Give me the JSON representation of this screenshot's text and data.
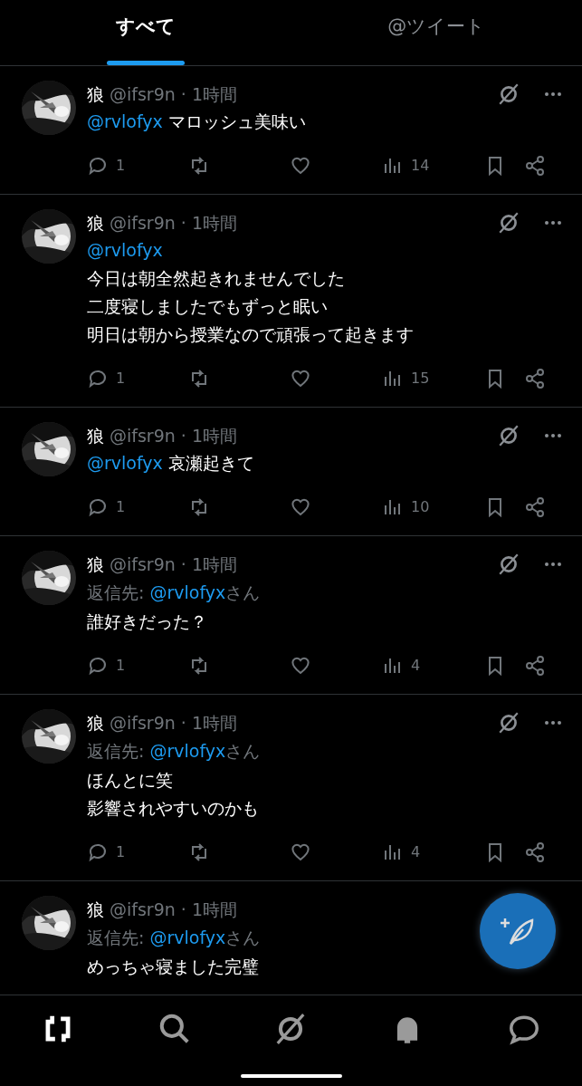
{
  "tabs": [
    {
      "label": "すべて",
      "selected": true
    },
    {
      "label": "@ツイート",
      "selected": false
    }
  ],
  "tweets": [
    {
      "name": "狼",
      "handle": "@ifsr9n",
      "time": "· 1時間",
      "body": [
        [
          {
            "kind": "mention",
            "text": "@rvlofyx"
          },
          {
            "kind": "text",
            "text": " マロッシュ美味い"
          }
        ]
      ],
      "replies": "1",
      "views": "14"
    },
    {
      "name": "狼",
      "handle": "@ifsr9n",
      "time": "· 1時間",
      "body": [
        [
          {
            "kind": "mention",
            "text": "@rvlofyx"
          }
        ],
        [
          {
            "kind": "text",
            "text": "今日は朝全然起きれませんでした"
          }
        ],
        [
          {
            "kind": "text",
            "text": "二度寝しましたでもずっと眠い"
          }
        ],
        [
          {
            "kind": "text",
            "text": "明日は朝から授業なので頑張って起きます"
          }
        ]
      ],
      "replies": "1",
      "views": "15"
    },
    {
      "name": "狼",
      "handle": "@ifsr9n",
      "time": "· 1時間",
      "body": [
        [
          {
            "kind": "mention",
            "text": "@rvlofyx"
          },
          {
            "kind": "text",
            "text": " 哀瀬起きて"
          }
        ]
      ],
      "replies": "1",
      "views": "10"
    },
    {
      "name": "狼",
      "handle": "@ifsr9n",
      "time": "· 1時間",
      "reply_to": {
        "prefix": "返信先: ",
        "handle": "@rvlofyx",
        "suffix": "さん"
      },
      "body": [
        [
          {
            "kind": "text",
            "text": "誰好きだった？"
          }
        ]
      ],
      "replies": "1",
      "views": "4"
    },
    {
      "name": "狼",
      "handle": "@ifsr9n",
      "time": "· 1時間",
      "reply_to": {
        "prefix": "返信先: ",
        "handle": "@rvlofyx",
        "suffix": "さん"
      },
      "body": [
        [
          {
            "kind": "text",
            "text": "ほんとに笑"
          }
        ],
        [
          {
            "kind": "text",
            "text": "影響されやすいのかも"
          }
        ]
      ],
      "replies": "1",
      "views": "4"
    },
    {
      "name": "狼",
      "handle": "@ifsr9n",
      "time": "· 1時間",
      "reply_to": {
        "prefix": "返信先: ",
        "handle": "@rvlofyx",
        "suffix": "さん"
      },
      "body": [
        [
          {
            "kind": "text",
            "text": "めっちゃ寝ました完璧"
          }
        ]
      ]
    }
  ],
  "nav": [
    {
      "kind": "timeline",
      "selected": true
    },
    {
      "kind": "search",
      "selected": false
    },
    {
      "kind": "ai",
      "selected": false
    },
    {
      "kind": "notifications",
      "selected": false
    },
    {
      "kind": "messages",
      "selected": false
    }
  ]
}
